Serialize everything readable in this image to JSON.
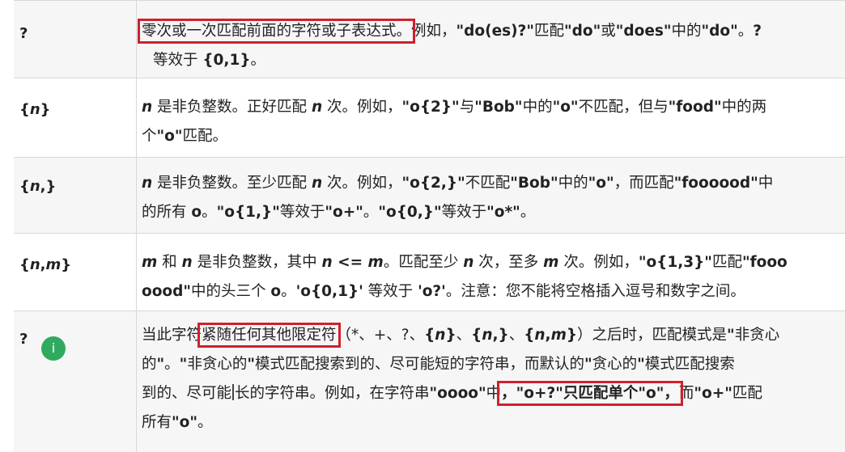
{
  "rows": [
    {
      "char": "?",
      "line1": [
        {
          "t": "零次或一次匹配前面的字符或子表达式。",
          "hl": true
        },
        {
          "t": "例如，"
        },
        {
          "t": "\"do(es)?\"",
          "b": true
        },
        {
          "t": "匹配"
        },
        {
          "t": "\"do\"",
          "b": true
        },
        {
          "t": "或"
        },
        {
          "t": "\"does\"",
          "b": true
        },
        {
          "t": "中的"
        },
        {
          "t": "\"do\"",
          "b": true
        },
        {
          "t": "。"
        },
        {
          "t": "?",
          "b": true
        }
      ],
      "line2": [
        {
          "t": "等效于 "
        },
        {
          "t": "{0,1}",
          "b": true
        },
        {
          "t": "。"
        }
      ]
    },
    {
      "char_pre": "{",
      "char_var": "n",
      "char_post": "}",
      "line1": [
        {
          "t": "n",
          "b": true,
          "i": true
        },
        {
          "t": " 是非负整数。正好匹配 "
        },
        {
          "t": "n",
          "b": true,
          "i": true
        },
        {
          "t": " 次。例如，"
        },
        {
          "t": "\"o{2}\"",
          "b": true
        },
        {
          "t": "与"
        },
        {
          "t": "\"Bob\"",
          "b": true
        },
        {
          "t": "中的"
        },
        {
          "t": "\"o\"",
          "b": true
        },
        {
          "t": "不匹配，但与"
        },
        {
          "t": "\"food\"",
          "b": true
        },
        {
          "t": "中的两"
        }
      ],
      "line2": [
        {
          "t": "个"
        },
        {
          "t": "\"o\"",
          "b": true
        },
        {
          "t": "匹配。"
        }
      ]
    },
    {
      "char_pre": "{",
      "char_var": "n",
      "char_post": ",}",
      "line1": [
        {
          "t": "n",
          "b": true,
          "i": true
        },
        {
          "t": " 是非负整数。至少匹配 "
        },
        {
          "t": "n",
          "b": true,
          "i": true
        },
        {
          "t": " 次。例如，"
        },
        {
          "t": "\"o{2,}\"",
          "b": true
        },
        {
          "t": "不匹配"
        },
        {
          "t": "\"Bob\"",
          "b": true
        },
        {
          "t": "中的"
        },
        {
          "t": "\"o\"",
          "b": true
        },
        {
          "t": "，而匹配"
        },
        {
          "t": "\"foooood\"",
          "b": true
        },
        {
          "t": "中"
        }
      ],
      "line2": [
        {
          "t": "的所有 "
        },
        {
          "t": "o",
          "b": true
        },
        {
          "t": "。"
        },
        {
          "t": "\"o{1,}\"",
          "b": true
        },
        {
          "t": "等效于"
        },
        {
          "t": "\"o+\"",
          "b": true
        },
        {
          "t": "。"
        },
        {
          "t": "\"o{0,}\"",
          "b": true
        },
        {
          "t": "等效于"
        },
        {
          "t": "\"o*\"",
          "b": true
        },
        {
          "t": "。"
        }
      ]
    },
    {
      "char_pre": "{",
      "char_var": "n",
      "char_mid": ",",
      "char_var2": "m",
      "char_post": "}",
      "line1": [
        {
          "t": "m",
          "b": true,
          "i": true
        },
        {
          "t": " 和 "
        },
        {
          "t": "n",
          "b": true,
          "i": true
        },
        {
          "t": " 是非负整数，其中 "
        },
        {
          "t": "n",
          "b": true,
          "i": true
        },
        {
          "t": " <= ",
          "b": true
        },
        {
          "t": "m",
          "b": true,
          "i": true
        },
        {
          "t": "。匹配至少 "
        },
        {
          "t": "n",
          "b": true,
          "i": true
        },
        {
          "t": " 次，至多 "
        },
        {
          "t": "m",
          "b": true,
          "i": true
        },
        {
          "t": " 次。例如，"
        },
        {
          "t": "\"o{1,3}\"",
          "b": true
        },
        {
          "t": "匹配"
        },
        {
          "t": "\"fooo",
          "b": true
        }
      ],
      "line2": [
        {
          "t": "oood\"",
          "b": true
        },
        {
          "t": "中的头三个 "
        },
        {
          "t": "o",
          "b": true
        },
        {
          "t": "。"
        },
        {
          "t": "'o{0,1}'",
          "b": true
        },
        {
          "t": " 等效于 "
        },
        {
          "t": "'o?'",
          "b": true
        },
        {
          "t": "。注意：您不能将空格插入逗号和数字之间。"
        }
      ]
    },
    {
      "char": "?",
      "badge": "i",
      "line1": [
        {
          "t": "当此字符"
        },
        {
          "t": "紧随任何其他限定符",
          "hl": true
        },
        {
          "t": "（*、+、?、"
        },
        {
          "t": "{",
          "b": true
        },
        {
          "t": "n",
          "b": true,
          "i": true
        },
        {
          "t": "}",
          "b": true
        },
        {
          "t": "、"
        },
        {
          "t": "{",
          "b": true
        },
        {
          "t": "n",
          "b": true,
          "i": true
        },
        {
          "t": ",}",
          "b": true
        },
        {
          "t": "、"
        },
        {
          "t": "{",
          "b": true
        },
        {
          "t": "n",
          "b": true,
          "i": true
        },
        {
          "t": ",",
          "b": true
        },
        {
          "t": "m",
          "b": true,
          "i": true
        },
        {
          "t": "}",
          "b": true
        },
        {
          "t": "）之后时，匹配模式是"
        },
        {
          "t": "\"",
          "b": true
        },
        {
          "t": "非贪心"
        }
      ],
      "line2": [
        {
          "t": "的"
        },
        {
          "t": "\"",
          "b": true
        },
        {
          "t": "。"
        },
        {
          "t": "\"",
          "b": true
        },
        {
          "t": "非贪心的"
        },
        {
          "t": "\"",
          "b": true
        },
        {
          "t": "模式匹配搜索到的、尽可能短的字符串，而默认的"
        },
        {
          "t": "\"",
          "b": true
        },
        {
          "t": "贪心的"
        },
        {
          "t": "\"",
          "b": true
        },
        {
          "t": "模式匹配搜索"
        }
      ],
      "line3": [
        {
          "t": "到的、尽可能"
        },
        {
          "cursor": true
        },
        {
          "t": "长的字符串。例如，在字符串"
        },
        {
          "t": "\"oooo\"",
          "b": true
        },
        {
          "t": "中"
        },
        {
          "t": "，\"o+?\"只匹配单个\"o\"，",
          "hl": true,
          "bq": true
        },
        {
          "t": "而"
        },
        {
          "t": "\"o+\"",
          "b": true
        },
        {
          "t": "匹配"
        }
      ],
      "line4": [
        {
          "t": "所有"
        },
        {
          "t": "\"o\"",
          "b": true
        },
        {
          "t": "。"
        }
      ]
    }
  ]
}
